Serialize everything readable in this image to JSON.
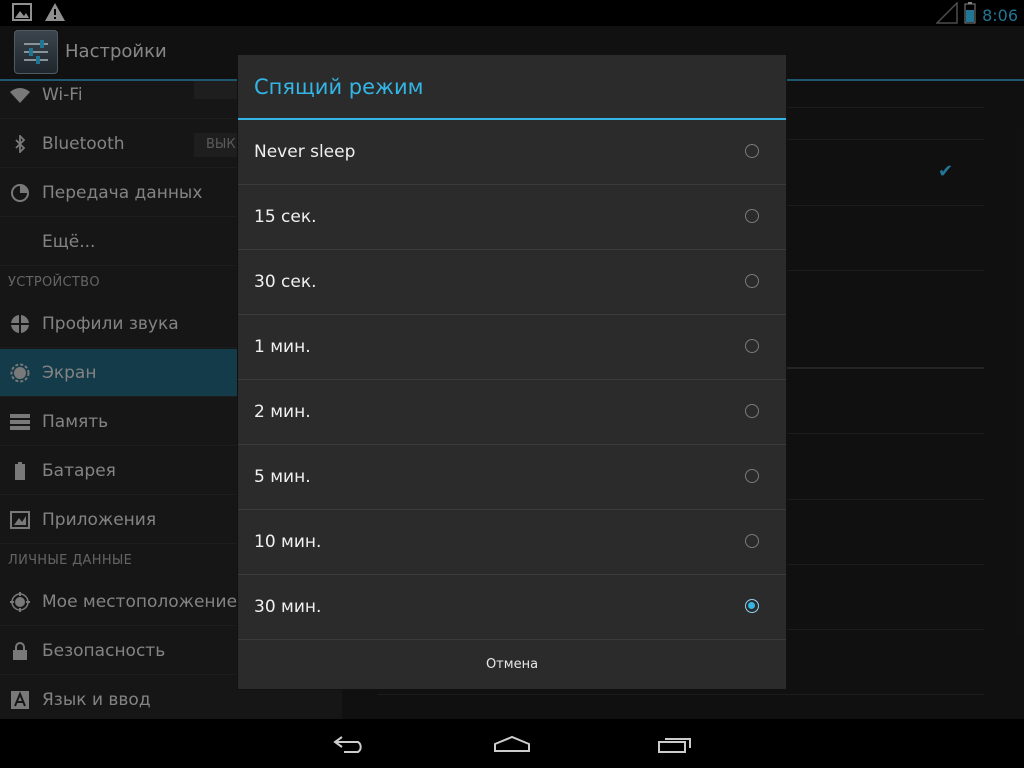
{
  "status_bar": {
    "left_icons": [
      "gallery-icon",
      "warning-icon"
    ],
    "right_icons": [
      "signal-icon",
      "battery-icon"
    ],
    "time": "8:06"
  },
  "action_bar": {
    "app_icon": "settings-icon",
    "title": "Настройки"
  },
  "sidebar": {
    "items": [
      {
        "label": "Wi-Fi",
        "icon": "wifi-icon"
      },
      {
        "label": "Bluetooth",
        "icon": "bluetooth-icon",
        "toggle": "ВЫК"
      },
      {
        "label": "Передача данных",
        "icon": "data-usage-icon"
      },
      {
        "label": "Ещё...",
        "icon": ""
      },
      {
        "label": "Профили звука",
        "icon": "sound-icon"
      },
      {
        "label": "Экран",
        "icon": "display-icon",
        "selected": true
      },
      {
        "label": "Память",
        "icon": "storage-icon"
      },
      {
        "label": "Батарея",
        "icon": "battery-settings-icon"
      },
      {
        "label": "Приложения",
        "icon": "apps-icon"
      },
      {
        "label": "Мое местоположение",
        "icon": "location-icon"
      },
      {
        "label": "Безопасность",
        "icon": "lock-icon"
      },
      {
        "label": "Язык и ввод",
        "icon": "language-icon"
      }
    ],
    "sections": {
      "device": "УСТРОЙСТВО",
      "personal": "ЛИЧНЫЕ ДАННЫЕ"
    }
  },
  "dialog": {
    "title": "Спящий режим",
    "options": [
      {
        "label": "Never sleep",
        "selected": false
      },
      {
        "label": "15 сек.",
        "selected": false
      },
      {
        "label": "30 сек.",
        "selected": false
      },
      {
        "label": "1 мин.",
        "selected": false
      },
      {
        "label": "2 мин.",
        "selected": false
      },
      {
        "label": "5 мин.",
        "selected": false
      },
      {
        "label": "10 мин.",
        "selected": false
      },
      {
        "label": "30 мин.",
        "selected": true
      }
    ],
    "cancel_label": "Отмена"
  },
  "nav_bar": {
    "buttons": [
      "back-icon",
      "home-icon",
      "recent-apps-icon"
    ]
  },
  "colors": {
    "accent": "#33b5e5",
    "selected_item": "#1f5b72",
    "dialog_bg": "#2b2b2b"
  }
}
